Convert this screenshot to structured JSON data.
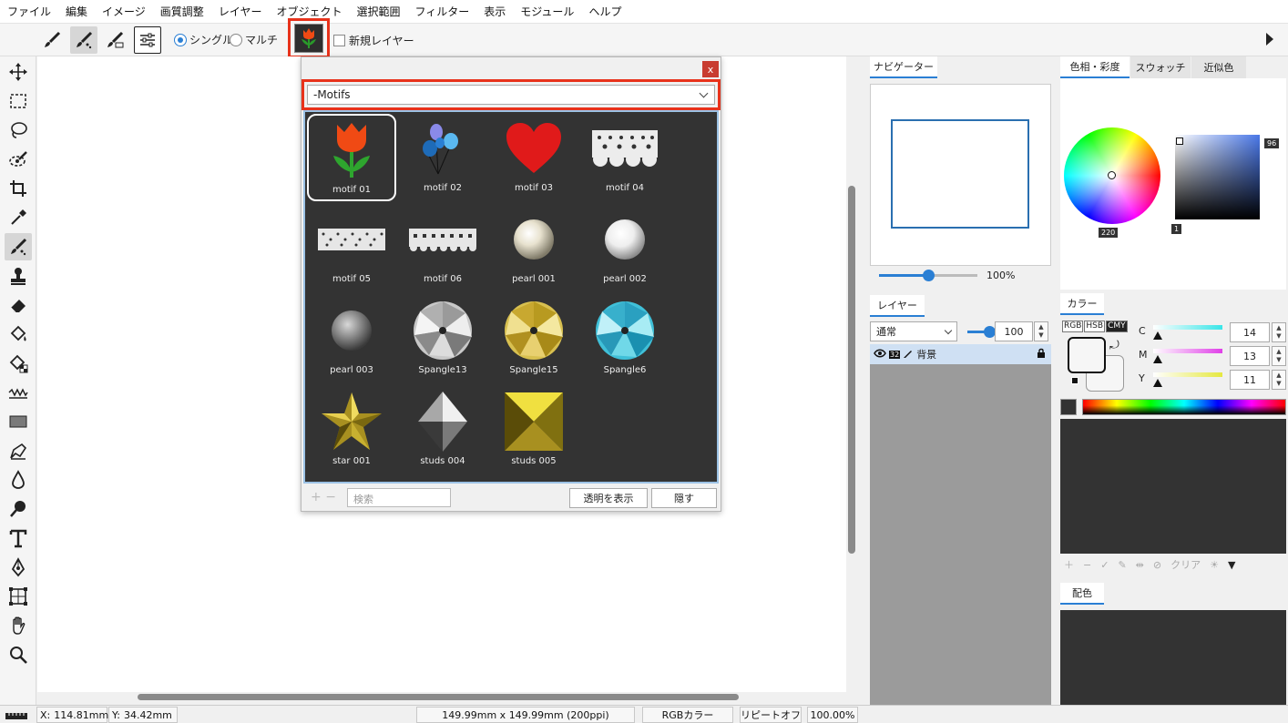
{
  "menu": [
    "ファイル",
    "編集",
    "イメージ",
    "画質調整",
    "レイヤー",
    "オブジェクト",
    "選択範囲",
    "フィルター",
    "表示",
    "モジュール",
    "ヘルプ"
  ],
  "toolbar": {
    "mode_single": "シングル",
    "mode_multi": "マルチ",
    "new_layer": "新規レイヤー",
    "selected_mode": "single"
  },
  "popup": {
    "close": "x",
    "category": "-Motifs",
    "motifs": [
      {
        "label": "motif 01",
        "icon": "tulip-icon"
      },
      {
        "label": "motif 02",
        "icon": "balloons-icon"
      },
      {
        "label": "motif 03",
        "icon": "heart-icon"
      },
      {
        "label": "motif 04",
        "icon": "lace-icon"
      },
      {
        "label": "motif 05",
        "icon": "lace-strip-icon"
      },
      {
        "label": "motif 06",
        "icon": "lace-strip-icon"
      },
      {
        "label": "pearl 001",
        "icon": "pearl-icon"
      },
      {
        "label": "pearl 002",
        "icon": "pearl-icon"
      },
      {
        "label": "pearl 003",
        "icon": "pearl-icon"
      },
      {
        "label": "Spangle13",
        "icon": "spangle-icon"
      },
      {
        "label": "Spangle15",
        "icon": "spangle-icon"
      },
      {
        "label": "Spangle6",
        "icon": "spangle-icon"
      },
      {
        "label": "star 001",
        "icon": "star-icon"
      },
      {
        "label": "studs 004",
        "icon": "stud-icon"
      },
      {
        "label": "studs 005",
        "icon": "stud-icon"
      }
    ],
    "search_placeholder": "検索",
    "show_transparent": "透明を表示",
    "hide": "隠す",
    "plus": "+",
    "minus": "−"
  },
  "navigator": {
    "tab": "ナビゲーター",
    "zoom": "100%",
    "zoom_level": 0.5
  },
  "layers": {
    "tab": "レイヤー",
    "blend": "通常",
    "opacity": "100",
    "opacity_level": 1.0,
    "row_badge": "32",
    "row_name": "背景"
  },
  "color_tabs": [
    "色相・彩度",
    "スウォッチ",
    "近似色"
  ],
  "hsb": {
    "saturation_tag": "96",
    "hue_tag": "220",
    "brightness_tag": "1"
  },
  "color": {
    "tab": "カラー",
    "modes": [
      "RGB",
      "HSB",
      "CMY"
    ],
    "active_mode": "CMY",
    "c_label": "C",
    "c_value": "14",
    "m_label": "M",
    "m_value": "13",
    "y_label": "Y",
    "y_value": "11",
    "c_gradient": "#39e5e8",
    "m_gradient": "#e040e8",
    "y_gradient": "#e5e840"
  },
  "palette": {
    "clear": "クリア"
  },
  "scheme": {
    "tab": "配色"
  },
  "status": {
    "x_label": "X:",
    "x_value": "114.81mm",
    "y_label": "Y:",
    "y_value": "34.42mm",
    "size": "149.99mm x 149.99mm (200ppi)",
    "color_mode": "RGBカラー",
    "repeat": "リピートオフ",
    "zoom": "100.00%"
  },
  "colors": {
    "accent": "#2a7fd4",
    "highlight_border": "#e8321b"
  }
}
